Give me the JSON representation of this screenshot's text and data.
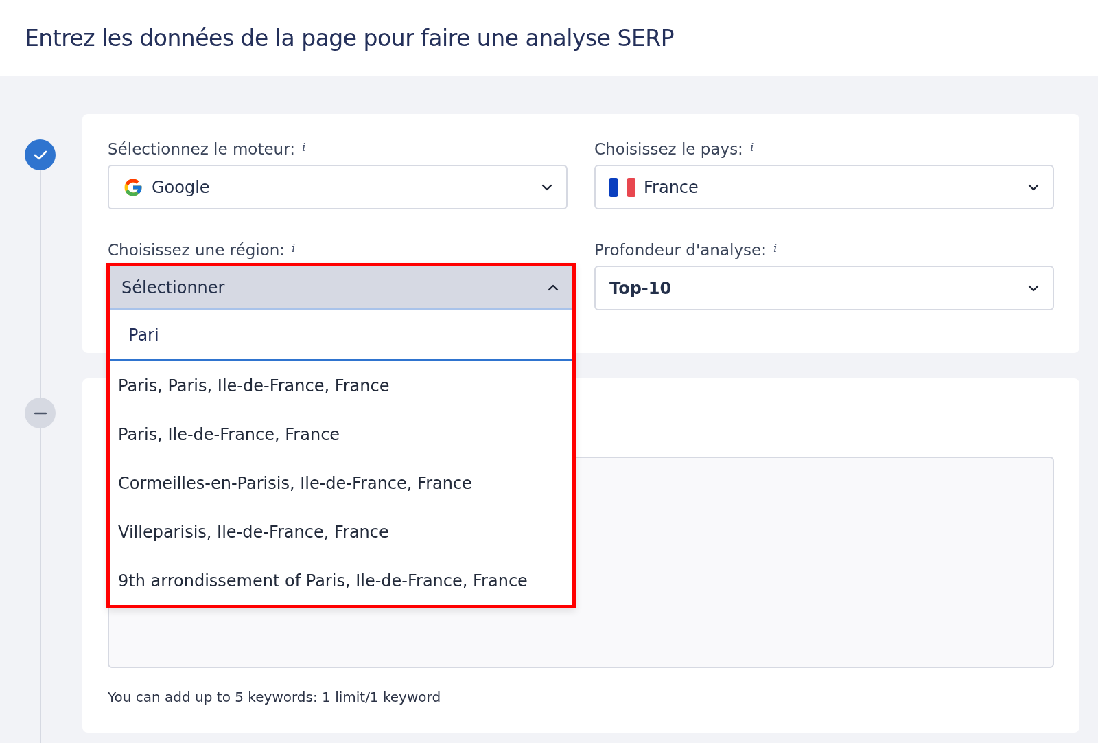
{
  "header": {
    "title": "Entrez les données de la page pour faire une analyse SERP"
  },
  "steps": [
    {
      "kind": "done"
    },
    {
      "kind": "collapsed"
    }
  ],
  "fields": [
    {
      "label": "Sélectionnez le moteur:",
      "info": "i",
      "kind": "engine",
      "value": "Google",
      "expanded": false
    },
    {
      "label": "Choisissez le pays:",
      "info": "i",
      "kind": "country",
      "value": "France",
      "expanded": false
    },
    {
      "label": "Choisissez une région:",
      "info": "i",
      "kind": "plain",
      "value": "Sélectionner",
      "expanded": true,
      "highlighted": true,
      "search": "Pari",
      "options": [
        "Paris, Paris, Ile-de-France, France",
        "Paris, Ile-de-France, France",
        "Cormeilles-en-Parisis, Ile-de-France, France",
        "Villeparisis, Ile-de-France, France",
        "9th arrondissement of Paris, Ile-de-France, France"
      ]
    },
    {
      "label": "Profondeur d'analyse:",
      "info": "i",
      "kind": "plain",
      "value": "Top-10",
      "expanded": false,
      "bold": true
    }
  ],
  "keywords": {
    "hint": "You can add up to 5 keywords: 1 limit/1 keyword"
  }
}
